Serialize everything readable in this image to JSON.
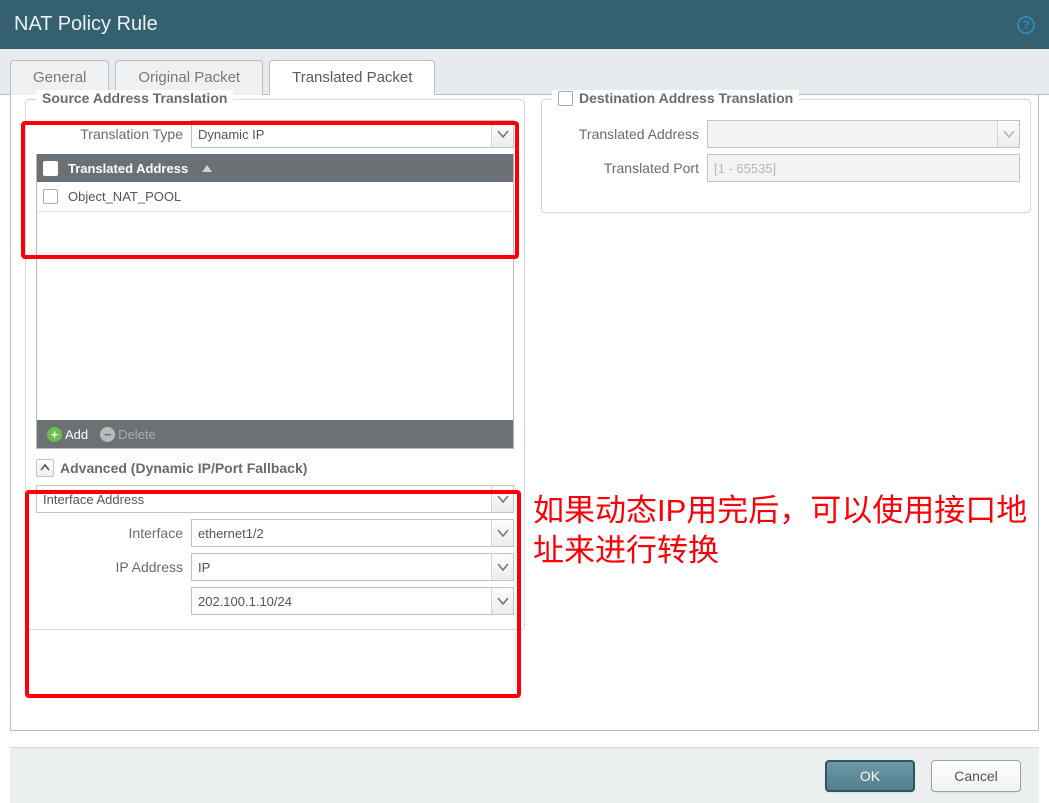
{
  "titlebar": {
    "title": "NAT Policy Rule"
  },
  "tabs": {
    "general": "General",
    "original": "Original Packet",
    "translated": "Translated Packet"
  },
  "src": {
    "group_title": "Source Address Translation",
    "translation_type_label": "Translation Type",
    "translation_type_value": "Dynamic IP",
    "grid_header": "Translated Address",
    "rows": [
      "Object_NAT_POOL"
    ],
    "add_label": "Add",
    "delete_label": "Delete",
    "adv_title": "Advanced (Dynamic IP/Port Fallback)",
    "adv_mode": "Interface Address",
    "interface_label": "Interface",
    "interface_value": "ethernet1/2",
    "ip_label": "IP Address",
    "ip_type": "IP",
    "ip_value": "202.100.1.10/24"
  },
  "dst": {
    "group_title": "Destination Address Translation",
    "translated_address_label": "Translated Address",
    "translated_port_label": "Translated Port",
    "translated_port_placeholder": "[1 - 65535]"
  },
  "annotation": "如果动态IP用完后，可以使用接口地址来进行转换",
  "footer": {
    "ok": "OK",
    "cancel": "Cancel"
  }
}
